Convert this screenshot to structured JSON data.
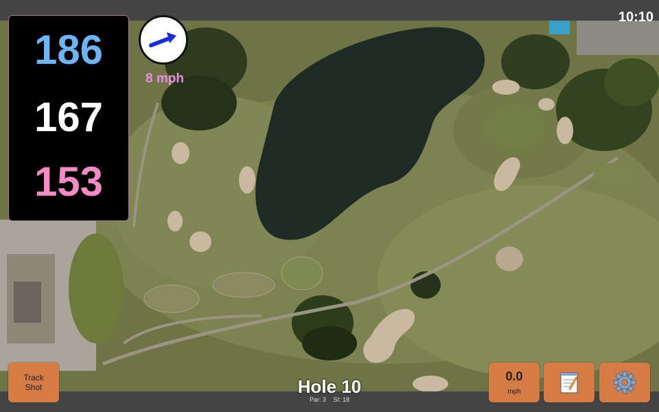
{
  "status": {
    "time": "10:10"
  },
  "distances": {
    "back": "186",
    "middle": "167",
    "front": "153"
  },
  "wind": {
    "speed": "8 mph",
    "direction": "east-north-east"
  },
  "buttons": {
    "track_shot": "Track Shot",
    "speed_value": "0.0",
    "speed_unit": "mph",
    "notes_icon": "notepad-icon",
    "settings_icon": "gear-icon"
  },
  "hole": {
    "title": "Hole 10",
    "par": "Par: 3",
    "si": "SI: 18"
  },
  "colors": {
    "back_distance": "#6fb4f2",
    "middle_distance": "#ffffff",
    "front_distance": "#f48bc6",
    "button": "#d57b45",
    "wind_text": "#ec8ee0",
    "wind_arrow": "#1a2bd8"
  }
}
